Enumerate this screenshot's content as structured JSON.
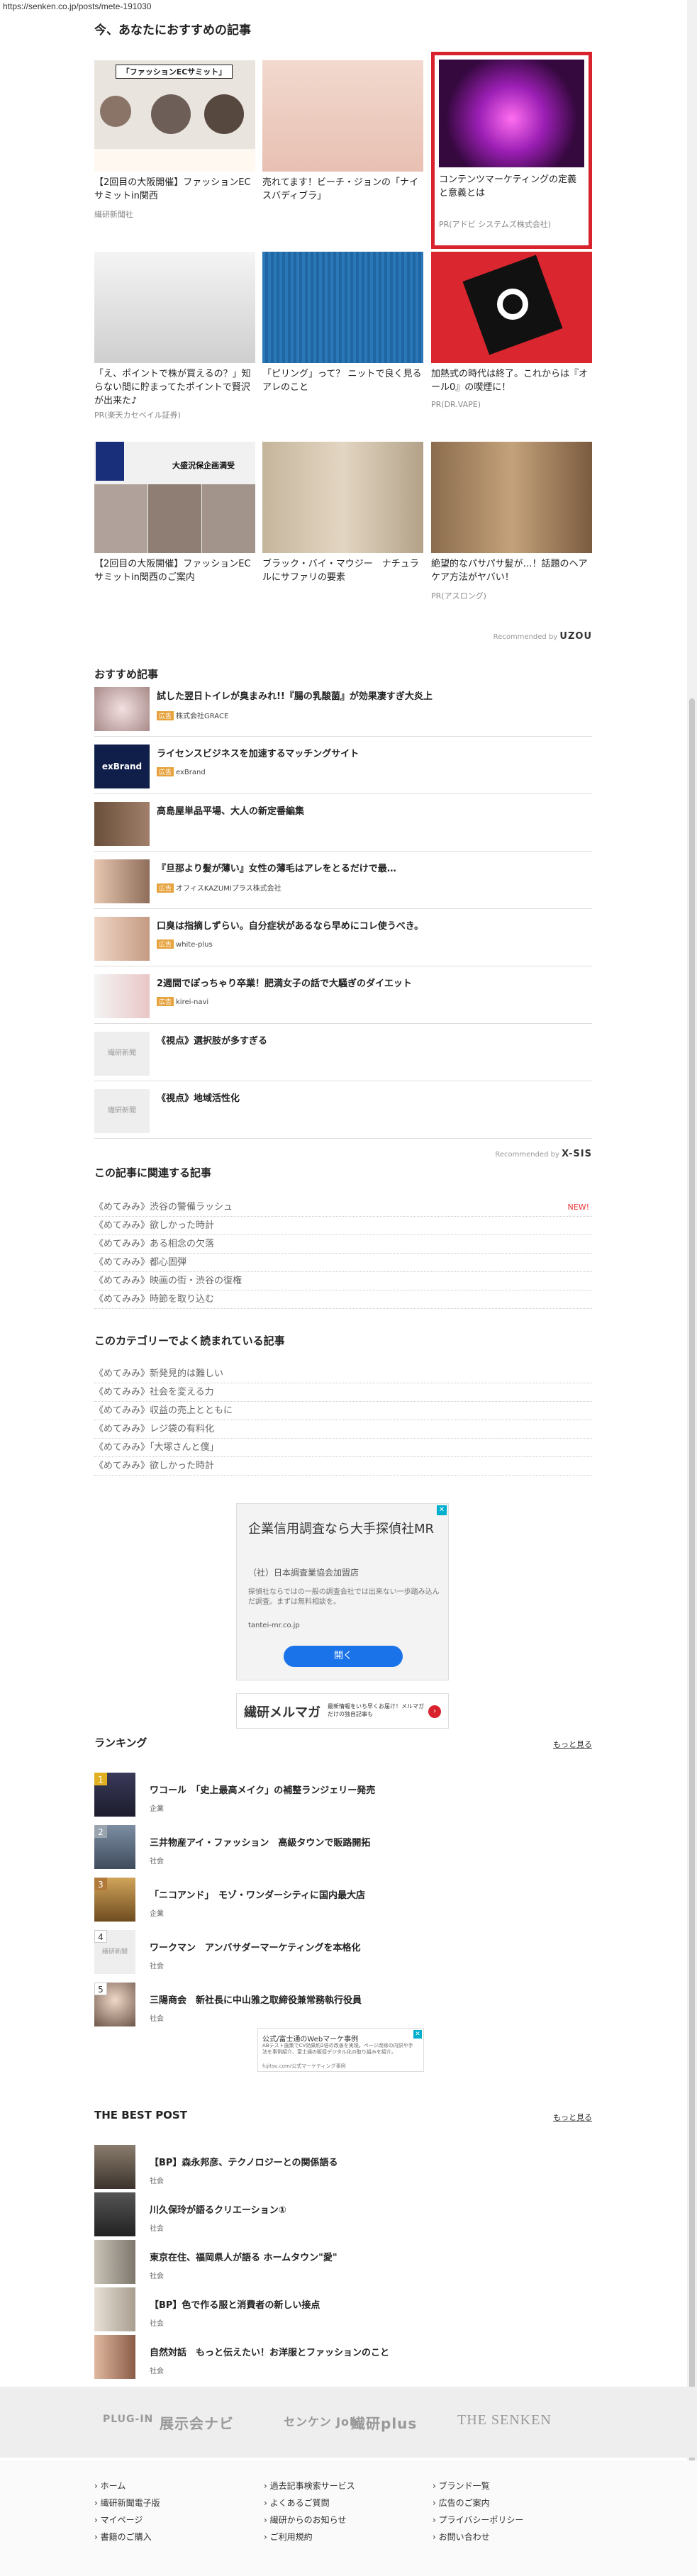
{
  "url": "https://senken.co.jp/posts/mete-191030",
  "recommended_section": {
    "title": "今、あなたにおすすめの記事",
    "recommended_by": "Recommended by",
    "brand": "UZOU",
    "cards": [
      {
        "title": "【2回目の大阪開催】ファッションECサミットin関西",
        "source": "繊研新聞社",
        "thumb_text": "「ファッションECサミット」"
      },
      {
        "title": "売れてます！ビーチ・ジョンの「ナイスバディブラ」",
        "source": ""
      },
      {
        "title": "コンテンツマーケティングの定義と意義とは",
        "source": "PR(アドビ システムズ株式会社)"
      },
      {
        "title": "「え、ポイントで株が買えるの？」知らない間に貯まってたポイントで賢沢が出来た♪",
        "source": "PR(楽天カセベイル証券)"
      },
      {
        "title": "「ピリング」って？ ニットで良く見るアレのこと",
        "source": ""
      },
      {
        "title": "加熱式の時代は終了。これからは『オール0』の喫煙に！",
        "source": "PR(DR.VAPE)"
      },
      {
        "title": "【2回目の大阪開催】ファッションECサミットin関西のご案内",
        "source": "",
        "thumb_text": "大盛況保企画満受"
      },
      {
        "title": "ブラック・バイ・マウジー　ナチュラルにサファリの要素",
        "source": ""
      },
      {
        "title": "絶望的なパサパサ髪が…！話題のヘアケア方法がヤバい！",
        "source": "PR(アスロング)"
      }
    ]
  },
  "osusume": {
    "title": "おすすめ記事",
    "recommended_by": "Recommended by",
    "brand": "X-SIS",
    "pr_label": "広告",
    "items": [
      {
        "title": "試した翌日トイレが臭まみれ!!『腸の乳酸菌』が効果凄すぎ大炎上",
        "sponsor": "株式会社GRACE",
        "pr": true
      },
      {
        "title": "ライセンスビジネスを加速するマッチングサイト",
        "sponsor": "exBrand",
        "pr": true,
        "thumb_text": "exBrand"
      },
      {
        "title": "高島屋単品平場、大人の新定番編集",
        "sponsor": "",
        "pr": false
      },
      {
        "title": "『旦那より髪が薄い』女性の薄毛はアレをとるだけで最…",
        "sponsor": "オフィスKAZUMIプラス株式会社",
        "pr": true
      },
      {
        "title": "口臭は指摘しずらい。自分症状があるなら早めにコレ使うべき。",
        "sponsor": "white-plus",
        "pr": true
      },
      {
        "title": "2週間でぽっちゃり卒業！肥満女子の話で大騒ぎのダイエット",
        "sponsor": "kirei-navi",
        "pr": true
      },
      {
        "title": "《視点》選択肢が多すぎる",
        "sponsor": "",
        "pr": false,
        "thumb_text": "繊研新聞"
      },
      {
        "title": "《視点》地域活性化",
        "sponsor": "",
        "pr": false,
        "thumb_text": "繊研新聞"
      }
    ]
  },
  "related": {
    "title": "この記事に関連する記事",
    "new_label": "NEW!",
    "items": [
      "《めてみみ》渋谷の警備ラッシュ",
      "《めてみみ》欲しかった時計",
      "《めてみみ》ある相念の欠落",
      "《めてみみ》都心固弾",
      "《めてみみ》映画の街・渋谷の復権",
      "《めてみみ》時節を取り込む"
    ]
  },
  "category": {
    "title": "このカテゴリーでよく読まれている記事",
    "items": [
      "《めてみみ》新発見的は難しい",
      "《めてみみ》社会を変える力",
      "《めてみみ》収益の売上とともに",
      "《めてみみ》レジ袋の有料化",
      "《めてみみ》「大塚さんと僕」",
      "《めてみみ》欲しかった時計"
    ]
  },
  "ad1": {
    "title": "企業信用調査なら大手探偵社MR",
    "company": "（社）日本調査業協会加盟店",
    "desc": "探偵社ならではの一般の調査会社では出来ない一歩踏み込んだ調査。まずは無料相談を。",
    "domain": "tantei-mr.co.jp",
    "button": "開く"
  },
  "ad2": {
    "logo": "繊研メルマガ",
    "text": "最新情報をいち早くお届け！メルマガだけの独自記事も"
  },
  "ranking": {
    "title": "ランキング",
    "more": "もっと見る",
    "items": [
      {
        "num": "1",
        "title": "ワコール　「史上最高メイク」の補整ランジェリー発売",
        "cat": "企業"
      },
      {
        "num": "2",
        "title": "三井物産アイ・ファッション　高級タウンで販路開拓",
        "cat": "社会"
      },
      {
        "num": "3",
        "title": "「ニコアンド」　モゾ・ワンダーシティに国内最大店",
        "cat": "企業"
      },
      {
        "num": "4",
        "title": "ワークマン　アンバサダーマーケティングを本格化",
        "cat": "社会",
        "thumb_text": "繊研新聞"
      },
      {
        "num": "5",
        "title": "三陽商会　新社長に中山雅之取締役兼常務執行役員",
        "cat": "社会"
      }
    ]
  },
  "ad3": {
    "text": "公式/富士通のWebマーケ事例",
    "sub": "ABテスト施策でCV効果約2倍の改善を実現。ページ改修の内訳や手法を事例紹介、富士通の販促デジタル化の取り組みを紹介。",
    "domain": "fujitsu.com/公式マーケティング事例"
  },
  "best": {
    "title": "THE BEST POST",
    "more": "もっと見る",
    "items": [
      {
        "title": "【BP】森永邦彦、テクノロジーとの関係語る",
        "cat": "社会"
      },
      {
        "title": "川久保玲が語るクリエーション①",
        "cat": "社会"
      },
      {
        "title": "東京在住、福岡県人が語る ホームタウン\"愛\"",
        "cat": "社会"
      },
      {
        "title": "【BP】色で作る服と消費者の新しい接点",
        "cat": "社会"
      },
      {
        "title": "自然対話　もっと伝えたい！お洋服とファッションのこと",
        "cat": "社会"
      }
    ]
  },
  "footer": {
    "logos": [
      "PLUG-IN",
      "展示会ナビ",
      "センケン Job",
      "繊研plus",
      "THE SENKEN"
    ],
    "links_col1": [
      "ホーム",
      "繊研新聞電子版",
      "マイページ",
      "書籍のご購入"
    ],
    "links_col2": [
      "過去記事検索サービス",
      "よくあるご質問",
      "繊研からのお知らせ",
      "ご利用規約"
    ],
    "links_col3": [
      "ブランド一覧",
      "広告のご案内",
      "プライバシーポリシー",
      "お問い合わせ"
    ]
  },
  "colors": {
    "accent": "#d8222d",
    "blue_button": "#1a73e8",
    "pr_badge": "#e6a23c"
  }
}
